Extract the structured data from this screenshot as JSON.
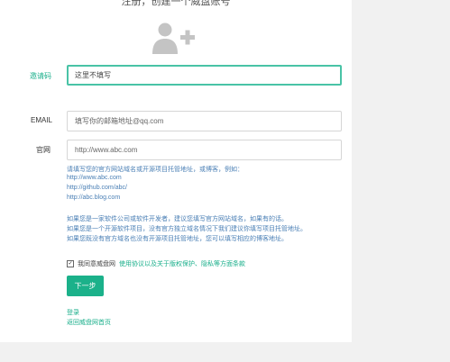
{
  "page_title": "注册，创建一个威盘账号",
  "form": {
    "invite_label": "邀请码",
    "invite_value": "这里不填写",
    "email_label": "EMAIL",
    "email_placeholder": "填写你的邮箱地址@qq.com",
    "site_label": "官网",
    "site_placeholder": "http://www.abc.com"
  },
  "hints": [
    "请填写您的官方网站域名或开源项目托管地址，或博客，例如：",
    "http://www.abc.com",
    "http://github.com/abc/",
    "http://abc.blog.com",
    "",
    "如果您是一家软件公司或软件开发者，建议您填写官方网站域名，如果有的话。",
    "如果您是一个开源软件项目，没有官方独立域名情况下我们建议你填写项目托管地址。",
    "如果您既没有官方域名也没有开源项目托管地址，您可以填写相应的博客地址。"
  ],
  "agreement": {
    "checked_mark": "✓",
    "text": "我同意威盘网",
    "link": "使用协议以及关于版权保护、隐私等方面条款"
  },
  "next_button": "下一步",
  "links": {
    "login": "登录",
    "home": "返回威盘网首页"
  },
  "colors": {
    "accent": "#1bb18a",
    "focus_border": "#49c3a6",
    "hint_text": "#4a7fb5",
    "icon": "#c4c4c4"
  }
}
